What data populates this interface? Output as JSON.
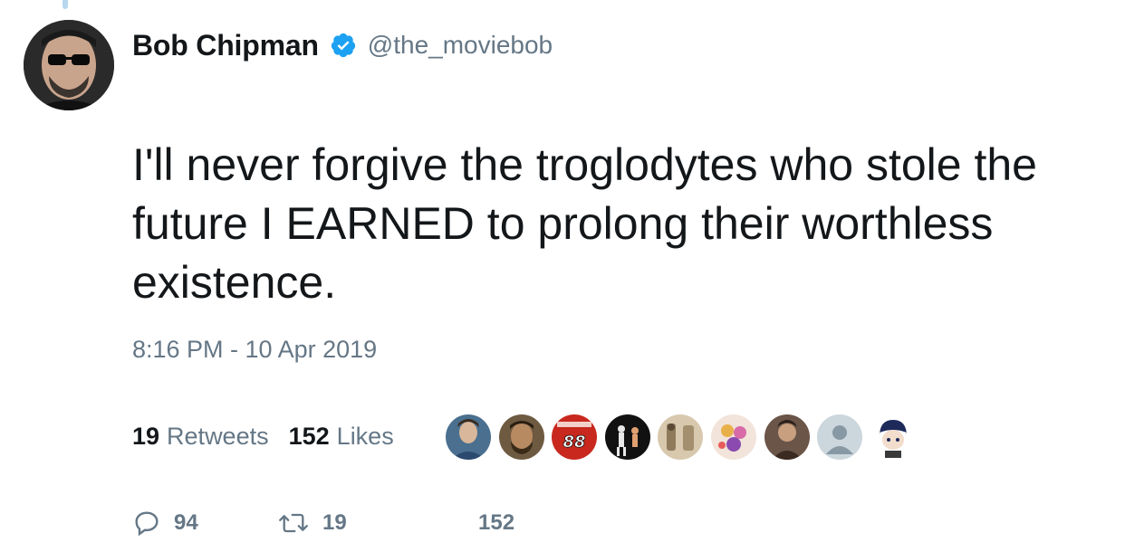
{
  "tweet": {
    "author": {
      "display_name": "Bob Chipman",
      "handle": "@the_moviebob",
      "verified": true,
      "avatar_icon": "profile-photo"
    },
    "text": "I'll never forgive the troglodytes who stole the future I EARNED to prolong their worthless existence.",
    "timestamp": "8:16 PM - 10 Apr 2019"
  },
  "stats": {
    "retweets_count": "19",
    "retweets_label": "Retweets",
    "likes_count": "152",
    "likes_label": "Likes"
  },
  "liker_avatars": [
    {
      "icon": "liker-avatar-1",
      "color": "#4a6f8f"
    },
    {
      "icon": "liker-avatar-2",
      "color": "#5a4a36"
    },
    {
      "icon": "liker-avatar-3",
      "color": "#c8281e",
      "label": "88"
    },
    {
      "icon": "liker-avatar-4",
      "color": "#111111"
    },
    {
      "icon": "liker-avatar-5",
      "color": "#c9b79c"
    },
    {
      "icon": "liker-avatar-6",
      "color": "#e8d2c4"
    },
    {
      "icon": "liker-avatar-7",
      "color": "#6b5548"
    },
    {
      "icon": "liker-avatar-8",
      "color": "#ccd6dd"
    },
    {
      "icon": "liker-avatar-9",
      "color": "#ffffff"
    }
  ],
  "actions": {
    "reply_count": "94",
    "retweet_count": "19",
    "like_count": "152"
  },
  "colors": {
    "verified_blue": "#1da1f2",
    "secondary_text": "#657786",
    "primary_text": "#14171a",
    "thread_line": "#b6d7ee"
  }
}
